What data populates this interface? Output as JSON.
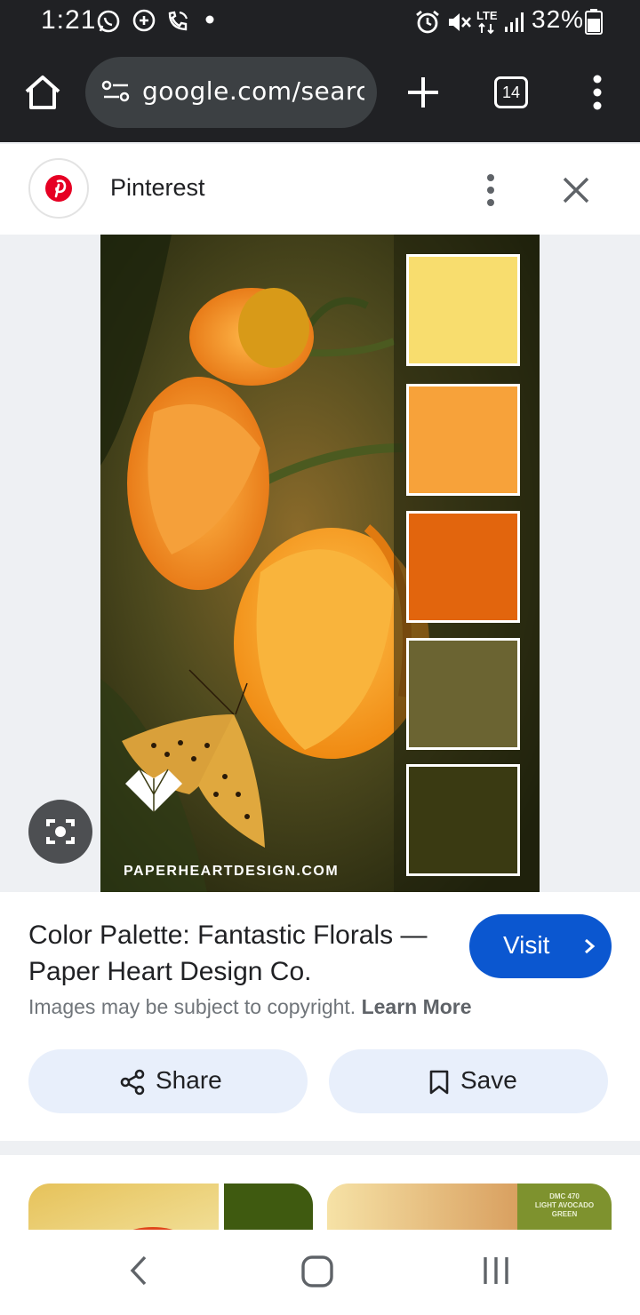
{
  "status_bar": {
    "time": "1:21",
    "battery": "32%",
    "network": "LTE",
    "left_icons": [
      "whatsapp-icon",
      "message-plus-icon",
      "call-icon",
      "dot-icon"
    ],
    "right_icons": [
      "alarm-icon",
      "mute-icon",
      "lte-icon",
      "signal-icon",
      "battery-icon"
    ]
  },
  "browser": {
    "url": "google.com/search?q",
    "tab_count": "14",
    "icons": [
      "home-icon",
      "tune-icon",
      "plus-icon",
      "tabs-icon",
      "more-vert-icon"
    ]
  },
  "source": {
    "name": "Pinterest",
    "logo": "pinterest-logo"
  },
  "image": {
    "watermark": "PAPERHEARTDESIGN.COM",
    "swatches": [
      "#f8dd6e",
      "#f7a23a",
      "#e2650d",
      "#6b6432",
      "#3a3a12"
    ]
  },
  "result": {
    "title": "Color Palette: Fantastic Florals — Paper Heart Design Co.",
    "visit_label": "Visit",
    "copyright_text": "Images may be subject to copyright.",
    "learn_more": "Learn More",
    "share_label": "Share",
    "save_label": "Save"
  },
  "related": {
    "thumb2_caption_line1": "DMC 470",
    "thumb2_caption_line2": "LIGHT AVOCADO",
    "thumb2_caption_line3": "GREEN"
  },
  "colors": {
    "accent": "#0b57d0",
    "toolbar": "#202124",
    "pinterest_red": "#e60023"
  }
}
